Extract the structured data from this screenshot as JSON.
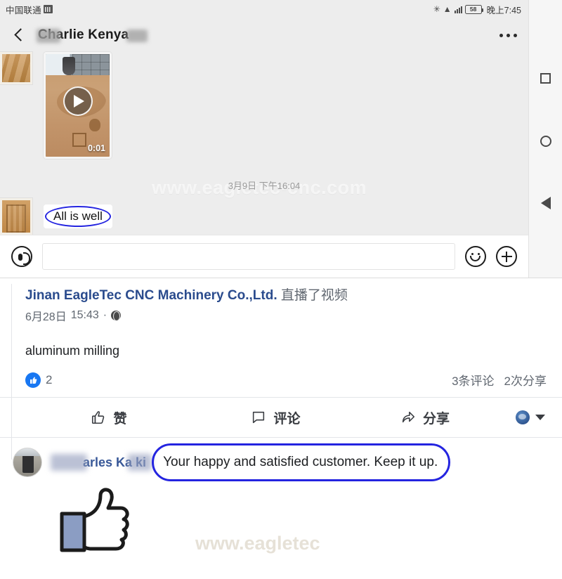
{
  "statusbar": {
    "carrier": "中国联通",
    "signal_icon": "signal-strength-icon",
    "bluetooth_icon": "bluetooth-icon",
    "wifi_icon": "wifi-icon",
    "battery_level": "58",
    "time": "晚上7:45"
  },
  "chat": {
    "back_icon": "back-chevron-icon",
    "title": "Charlie Kenya",
    "menu_icon": "overflow-menu-icon",
    "watermark": "www.eagletec-cnc.com",
    "timestamp": "3月9日 下午16:04",
    "video": {
      "duration": "0:01",
      "play_icon": "play-icon"
    },
    "message_text": "All is well",
    "input": {
      "value": "",
      "placeholder": "",
      "voice_icon": "voice-record-icon",
      "emoji_icon": "emoji-smiley-icon",
      "plus_icon": "add-attachment-icon"
    }
  },
  "navbar": {
    "recents_icon": "recents-square-icon",
    "home_icon": "home-circle-icon",
    "back_icon": "back-triangle-icon"
  },
  "facebook": {
    "author": "Jinan EagleTec CNC Machinery Co.,Ltd.",
    "action": "直播了视频",
    "date": "6月28日",
    "time": "15:43",
    "separator": "·",
    "privacy_icon": "globe-public-icon",
    "body_text": "aluminum milling",
    "reactions": {
      "like_icon": "thumbs-up-filled-icon",
      "count": "2",
      "comments": "3条评论",
      "shares": "2次分享"
    },
    "actions": [
      {
        "label": "赞",
        "icon": "thumbs-up-outline-icon"
      },
      {
        "label": "评论",
        "icon": "comment-bubble-icon"
      },
      {
        "label": "分享",
        "icon": "share-arrow-icon"
      }
    ],
    "profile_avatar_icon": "profile-avatar-icon",
    "dropdown_icon": "caret-down-icon",
    "comment": {
      "avatar_icon": "commenter-avatar-icon",
      "author": "arles Ka      ki",
      "text": "Your happy and satisfied customer. Keep it up.",
      "sticker_icon": "thumbs-up-sticker-icon"
    },
    "watermark": "www.eagletec"
  },
  "colors": {
    "highlight": "#2424e0",
    "facebook_blue": "#1877f2",
    "link_blue": "#385898",
    "author_blue": "#2a4b8d",
    "chat_bg": "#ededed"
  }
}
